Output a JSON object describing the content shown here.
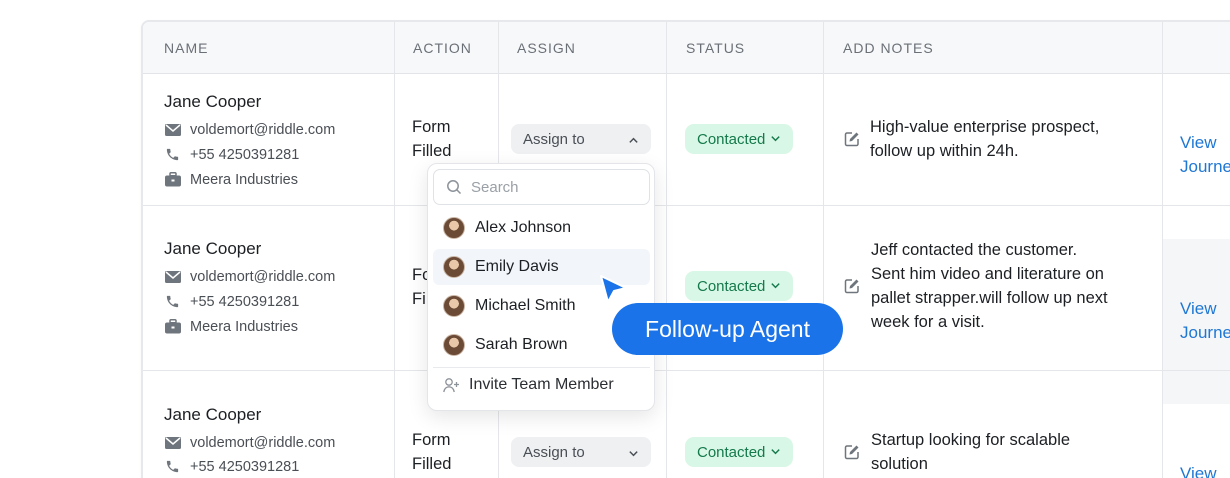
{
  "headers": {
    "name": "NAME",
    "action": "ACTION",
    "assign": "ASSIGN",
    "status": "STATUS",
    "notes": "ADD NOTES"
  },
  "rows": [
    {
      "name": "Jane Cooper",
      "email": "voldemort@riddle.com",
      "phone": "+55 4250391281",
      "company": "Meera Industries",
      "action_line1": "Form",
      "action_line2": "Filled",
      "assign": "Assign to",
      "status": "Contacted",
      "note_lines": [
        "High-value enterprise prospect,",
        "follow up within 24h."
      ],
      "view_line1": "View",
      "view_line2": "Journey"
    },
    {
      "name": "Jane Cooper",
      "email": "voldemort@riddle.com",
      "phone": "+55 4250391281",
      "company": "Meera Industries",
      "action_line1": "Fo",
      "action_line2": "Fi",
      "status": "Contacted",
      "note_lines": [
        "Jeff contacted the customer.",
        "Sent him video and literature on",
        "pallet strapper.will follow up next",
        "week for a visit."
      ],
      "view_line1": "View",
      "view_line2": "Journey"
    },
    {
      "name": "Jane Cooper",
      "email": "voldemort@riddle.com",
      "phone": "+55 4250391281",
      "action_line1": "Form",
      "action_line2": "Filled",
      "assign": "Assign to",
      "status": "Contacted",
      "note_lines": [
        "Startup looking for scalable",
        "solution"
      ],
      "view_line1": "View"
    }
  ],
  "dropdown": {
    "search_placeholder": "Search",
    "members": [
      "Alex Johnson",
      "Emily Davis",
      "Michael Smith",
      "Sarah Brown"
    ],
    "invite_label": "Invite Team Member"
  },
  "tooltip": "Follow-up Agent",
  "colors": {
    "status_bg": "#d9f7e6",
    "status_text": "#14794b",
    "link": "#1f77d4",
    "tooltip_bg": "#1a73e8"
  },
  "icons": [
    "mail-icon",
    "phone-icon",
    "briefcase-icon",
    "chevron-down-icon",
    "chevron-up-icon",
    "edit-icon",
    "search-icon",
    "add-user-icon",
    "cursor-pointer-icon"
  ]
}
